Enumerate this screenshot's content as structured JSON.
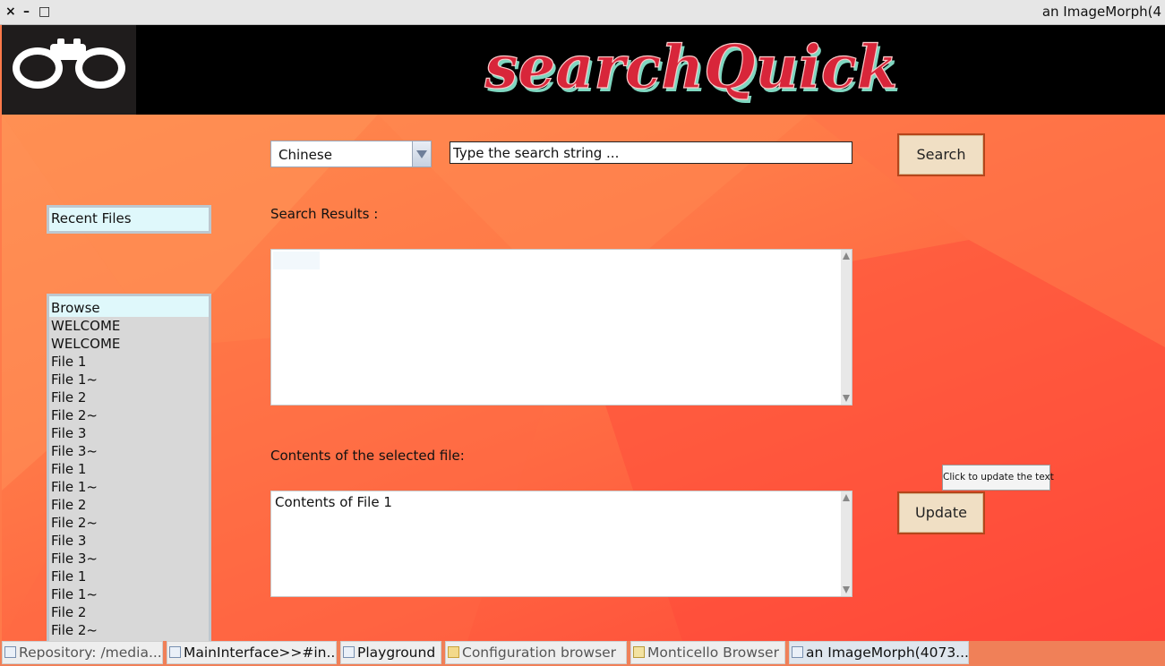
{
  "window": {
    "title": "an ImageMorph(4",
    "close_label": "×",
    "minimize_label": "–",
    "maximize_label": "□"
  },
  "header": {
    "brand_text": "searchQuick",
    "logo_icon": "binoculars-icon",
    "colors": {
      "background": "#000000",
      "brand_fill": "#d8263a",
      "brand_outline": "#7fd6c0"
    }
  },
  "search": {
    "language_selected": "Chinese",
    "input_value": "Type the search string ...",
    "button_label": "Search"
  },
  "sidebar": {
    "recent_files_label": "Recent Files",
    "list_header": "Browse",
    "items": [
      "WELCOME",
      "WELCOME",
      "File 1",
      "File 1~",
      "File 2",
      "File 2~",
      "File 3",
      "File 3~",
      "File 1",
      "File 1~",
      "File 2",
      "File 2~",
      "File 3",
      "File 3~",
      "File 1",
      "File 1~",
      "File 2",
      "File 2~"
    ]
  },
  "results": {
    "label": "Search Results :"
  },
  "contents": {
    "label": "Contents of the selected file:",
    "text": "Contents of File 1",
    "update_label": "Update",
    "update_tooltip": "Click to update the text"
  },
  "taskbar": {
    "items": [
      {
        "label": "Repository: /media...",
        "icon": "disk-icon"
      },
      {
        "label": "MainInterface>>#in...",
        "icon": "class-browser-icon"
      },
      {
        "label": "Playground",
        "icon": "playground-icon"
      },
      {
        "label": "Configuration browser",
        "icon": "package-icon"
      },
      {
        "label": "Monticello Browser",
        "icon": "monticello-icon"
      },
      {
        "label": "an ImageMorph(4073...",
        "icon": "window-icon"
      }
    ]
  }
}
